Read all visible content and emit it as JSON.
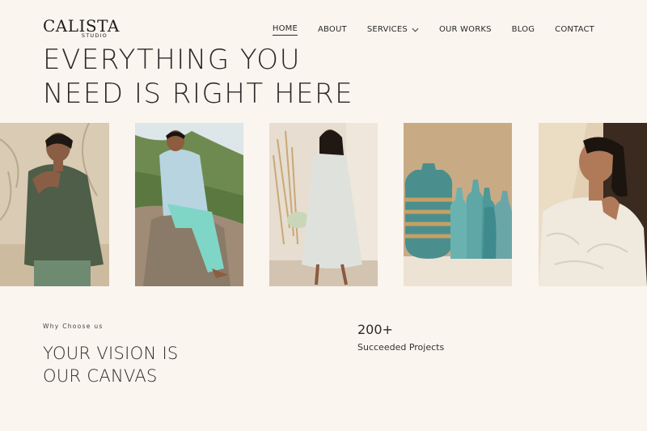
{
  "brand": {
    "name": "CALISTA",
    "sub": "STUDIO"
  },
  "nav": {
    "items": [
      {
        "label": "HOME"
      },
      {
        "label": "ABOUT"
      },
      {
        "label": "SERVICES"
      },
      {
        "label": "OUR WORKS"
      },
      {
        "label": "BLOG"
      },
      {
        "label": "CONTACT"
      }
    ],
    "active": "HOME"
  },
  "hero": {
    "line1": "EVERYTHING YOU",
    "line2": "NEED IS RIGHT HERE"
  },
  "section": {
    "tagline": "Why Choose us",
    "heading_line1": "YOUR VISION IS",
    "heading_line2": "OUR CANVAS"
  },
  "stat": {
    "value": "200+",
    "label": "Succeeded Projects"
  },
  "colors": {
    "background": "#faf5ee",
    "text": "#2a2a2a",
    "accent": "#5fb2b5"
  }
}
